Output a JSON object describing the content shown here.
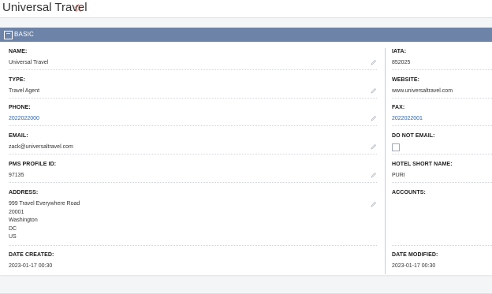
{
  "header": {
    "title": "Universal Travel",
    "favorite_icon": "star-outline-icon"
  },
  "panel": {
    "title": "BASIC",
    "toggle_icon": "minus-icon"
  },
  "fields_left": {
    "name": {
      "label": "NAME:",
      "value": "Universal Travel"
    },
    "type": {
      "label": "TYPE:",
      "value": "Travel Agent"
    },
    "phone": {
      "label": "PHONE:",
      "value": "2022022000"
    },
    "email": {
      "label": "EMAIL:",
      "value": "zack@universaltravel.com"
    },
    "pms_profile_id": {
      "label": "PMS PROFILE ID:",
      "value": "97135"
    },
    "address": {
      "label": "ADDRESS:",
      "line1": "999 Travel Everywhere Road",
      "line2": "20001",
      "line3": "Washington",
      "line4": "DC",
      "line5": "US"
    },
    "date_created": {
      "label": "DATE CREATED:",
      "value": "2023-01-17 00:30"
    }
  },
  "fields_right": {
    "iata": {
      "label": "IATA:",
      "value": "852025"
    },
    "website": {
      "label": "WEBSITE:",
      "value": "www.universaltravel.com"
    },
    "fax": {
      "label": "FAX:",
      "value": "2022022001"
    },
    "do_not_email": {
      "label": "DO NOT EMAIL:",
      "checked": false
    },
    "hotel_short_name": {
      "label": "HOTEL SHORT NAME:",
      "value": "PURI"
    },
    "accounts": {
      "label": "ACCOUNTS:",
      "value": ""
    },
    "date_modified": {
      "label": "DATE MODIFIED:",
      "value": "2023-01-17 00:30"
    }
  },
  "colors": {
    "panel_header": "#6d83a8",
    "link": "#2a62b0",
    "star": "#c0392b"
  }
}
